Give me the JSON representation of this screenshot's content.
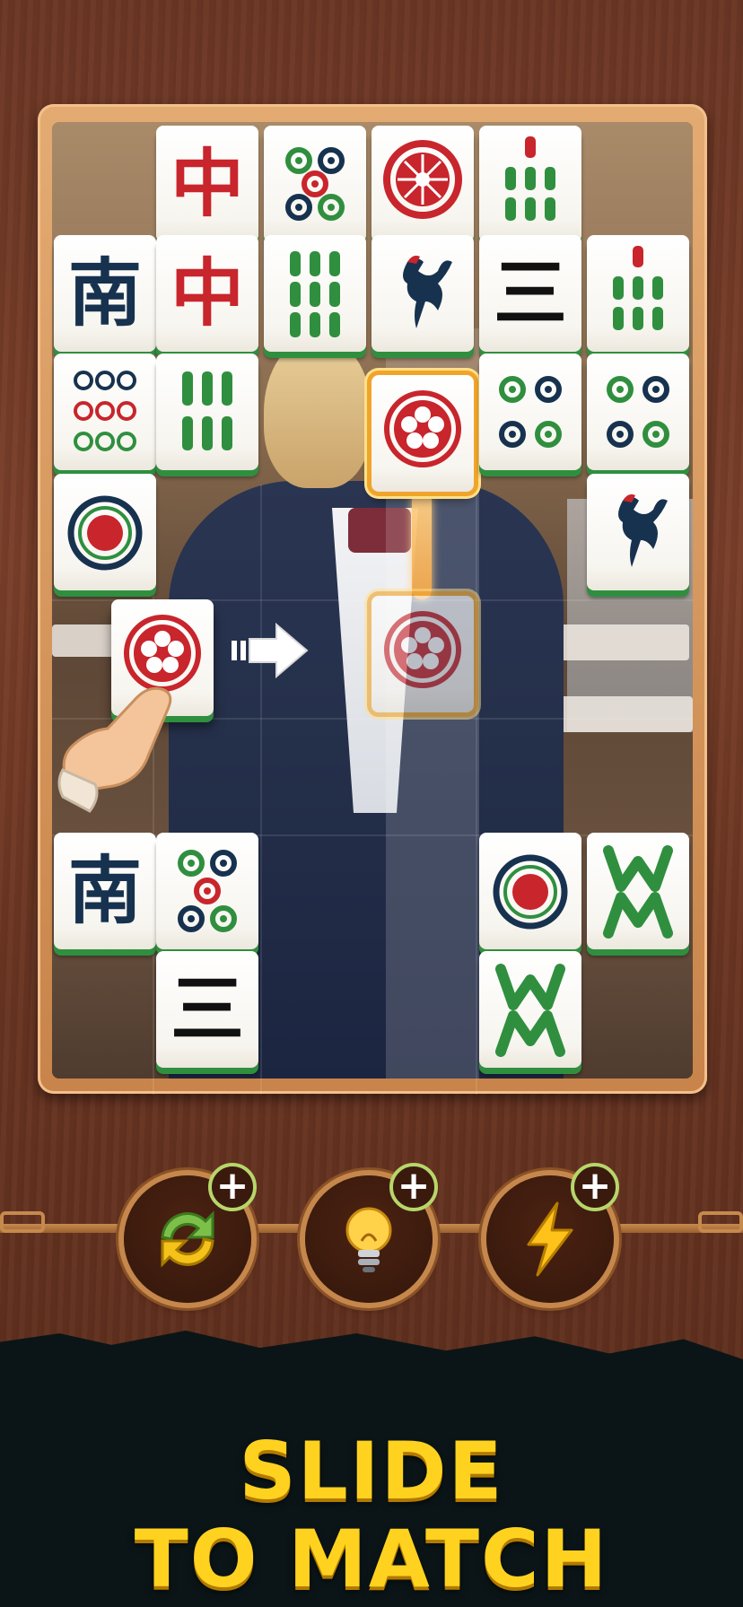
{
  "board": {
    "tiles": [
      {
        "id": "r0c1",
        "face": "中",
        "kind": "character",
        "color": "#c8252c"
      },
      {
        "id": "r0c2",
        "face": "circles-5",
        "kind": "dots"
      },
      {
        "id": "r0c3",
        "face": "big-wheel",
        "kind": "dots"
      },
      {
        "id": "r0c4",
        "face": "bamboo-7",
        "kind": "bamboo"
      },
      {
        "id": "r1c0",
        "face": "南",
        "kind": "character",
        "color": "#17324f"
      },
      {
        "id": "r1c1",
        "face": "中",
        "kind": "character",
        "color": "#c8252c"
      },
      {
        "id": "r1c2",
        "face": "bamboo-9",
        "kind": "bamboo"
      },
      {
        "id": "r1c3",
        "face": "bird",
        "kind": "bamboo-1"
      },
      {
        "id": "r1c4",
        "face": "三",
        "kind": "character",
        "color": "#111111"
      },
      {
        "id": "r1c5",
        "face": "bamboo-7",
        "kind": "bamboo"
      },
      {
        "id": "r2c0",
        "face": "circles-9",
        "kind": "dots"
      },
      {
        "id": "r2c1",
        "face": "bamboo-6",
        "kind": "bamboo"
      },
      {
        "id": "r2c3",
        "face": "plum-blossom",
        "kind": "flower",
        "state": "selected"
      },
      {
        "id": "r2c4",
        "face": "circles-4",
        "kind": "dots"
      },
      {
        "id": "r2c5",
        "face": "circles-4",
        "kind": "dots"
      },
      {
        "id": "r3c0",
        "face": "circle-1",
        "kind": "dots"
      },
      {
        "id": "r3c5",
        "face": "bird",
        "kind": "bamboo-1"
      },
      {
        "id": "r4c0",
        "face": "plum-blossom",
        "kind": "flower",
        "state": "dragging"
      },
      {
        "id": "r4c3",
        "face": "plum-blossom",
        "kind": "flower",
        "state": "target"
      },
      {
        "id": "r6c0",
        "face": "南",
        "kind": "character",
        "color": "#17324f"
      },
      {
        "id": "r6c1",
        "face": "circles-5",
        "kind": "dots"
      },
      {
        "id": "r6c4",
        "face": "circle-1",
        "kind": "dots"
      },
      {
        "id": "r6c5",
        "face": "green-dragon",
        "kind": "honor"
      },
      {
        "id": "r7c1",
        "face": "三",
        "kind": "character",
        "color": "#111111"
      },
      {
        "id": "r7c4",
        "face": "green-dragon",
        "kind": "honor"
      }
    ],
    "tile_colors": {
      "face": "#f7f5ef",
      "edge": "#2f8f3f",
      "selection": "#f0a52a"
    }
  },
  "tutorial": {
    "arrow_icon": "right-arrow-icon",
    "hand_icon": "pointing-hand-icon"
  },
  "powerups": [
    {
      "name": "shuffle",
      "icon": "shuffle-icon",
      "badge": "+"
    },
    {
      "name": "hint",
      "icon": "lightbulb-icon",
      "badge": "+"
    },
    {
      "name": "boost",
      "icon": "lightning-icon",
      "badge": "+"
    }
  ],
  "headline": {
    "line1": "SLIDE",
    "line2": "TO MATCH",
    "color": "#ffd21f"
  }
}
